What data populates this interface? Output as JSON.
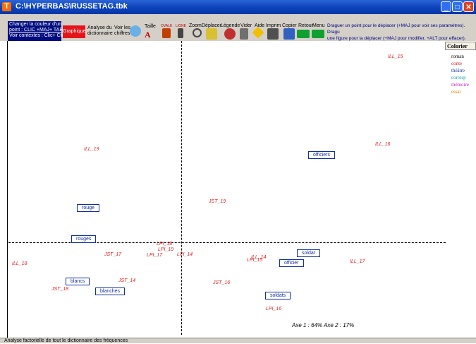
{
  "window": {
    "title": "C:\\HYPERBAS\\RUSSETAG.tbk",
    "app_icon": "T"
  },
  "toolbar": {
    "color_help": [
      "Changer la couleur d'un",
      "point : CLIC +MAJ+ TAB",
      "Voir contextes : Clic+ Ctrl"
    ],
    "graphique": "Graphique",
    "analyse": [
      "Analyse du",
      "dictionnaire"
    ],
    "voir_chiffres": [
      "Voir les",
      "chiffres"
    ],
    "taille": "Taille",
    "ovale": "OVALE",
    "ligne": "LIGNE",
    "zoom": "Zoom",
    "deplacer": "Déplacer",
    "legende": "Légende",
    "vider": "Vider",
    "aide": "Aide",
    "imprim": "Imprim",
    "copier": "Copier",
    "retour": "Retour",
    "menu": "Menu",
    "help_text": [
      "Draguer un point pour le déplacer (+MAJ pour voir ses paramètres). Dragu",
      "une figure pour la déplacer (+MAJ pour modifier, +ALT pour effacer)."
    ]
  },
  "legend": {
    "button": "Colorier",
    "items": [
      {
        "label": "roman",
        "color": "#000000"
      },
      {
        "label": "conte",
        "color": "#e02020"
      },
      {
        "label": "théâtre",
        "color": "#1030a0"
      },
      {
        "label": "corresp",
        "color": "#10a0a0"
      },
      {
        "label": "mémoire",
        "color": "#c020c0"
      },
      {
        "label": "essai",
        "color": "#e08000"
      }
    ]
  },
  "plot": {
    "points": [
      "ILL_15",
      "ILL_16",
      "ILL_19",
      "JST_19",
      "LPI_18",
      "LPI_19",
      "LPI_17",
      "LPI_14",
      "JST_17",
      "ILL_18",
      "ILL_14",
      "LPI_15",
      "ILL_17",
      "JST_14",
      "JST_18",
      "JST_16",
      "LPI_16"
    ],
    "words": [
      "officiers",
      "rouge",
      "rouges",
      "soldat",
      "officier",
      "blancs",
      "blanches",
      "soldats"
    ],
    "axis_info": "Axe 1 : 64%    Axe 2 : 17%"
  },
  "status": "Analyse factorielle de tout le dictionnaire des fréquences"
}
